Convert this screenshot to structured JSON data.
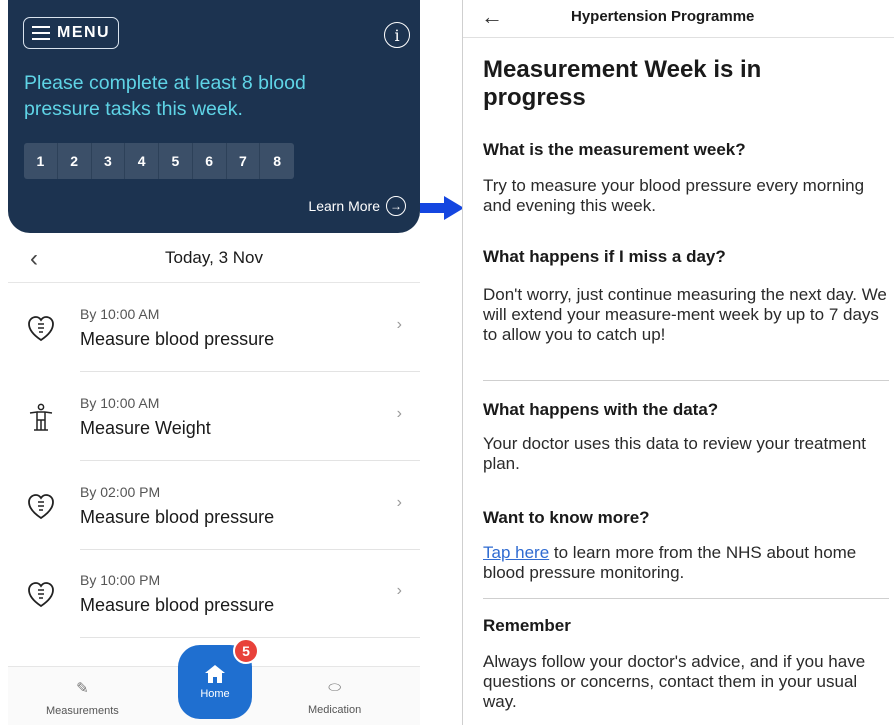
{
  "left": {
    "menu_label": "MENU",
    "info_icon": "info-icon",
    "hero_message": "Please complete at least 8 blood pressure tasks this week.",
    "task_numbers": [
      "1",
      "2",
      "3",
      "4",
      "5",
      "6",
      "7",
      "8"
    ],
    "learn_more": "Learn More",
    "date_title": "Today, 3 Nov",
    "tasks": [
      {
        "time": "By 10:00 AM",
        "name": "Measure blood pressure",
        "icon": "heart-icon"
      },
      {
        "time": "By 10:00 AM",
        "name": "Measure Weight",
        "icon": "person-icon"
      },
      {
        "time": "By 02:00 PM",
        "name": "Measure blood pressure",
        "icon": "heart-icon"
      },
      {
        "time": "By 10:00 PM",
        "name": "Measure blood pressure",
        "icon": "heart-icon"
      }
    ],
    "tabbar": {
      "measurements": "Measurements",
      "home": "Home",
      "medication": "Medication",
      "badge": "5"
    },
    "colors": {
      "hero_bg": "#1c3350",
      "hero_text": "#5fd4e6",
      "fab": "#1f6fd0",
      "badge": "#e8413a"
    }
  },
  "right": {
    "header_title": "Hypertension Programme",
    "heading": "Measurement Week is in progress",
    "sections": {
      "s1_title": "What is the measurement week?",
      "s1_body": "Try to measure your blood pressure every morning and evening this week.",
      "s2_title": "What happens if I miss a day?",
      "s2_body": "Don't worry, just continue measuring the next day. We will extend your measure-ment week by up to 7 days to allow you to catch up!",
      "s3_title": "What happens with the data?",
      "s3_body": "Your doctor uses this data to review your treatment plan.",
      "s4_title": "Want to know more?",
      "s4_link": "Tap here",
      "s4_body": " to learn more from the NHS about home blood pressure monitoring.",
      "s5_title": "Remember",
      "s5_body": "Always follow your doctor's advice, and if you have questions or concerns, contact them in your usual way."
    },
    "colors": {
      "link": "#2f6bd1"
    }
  }
}
